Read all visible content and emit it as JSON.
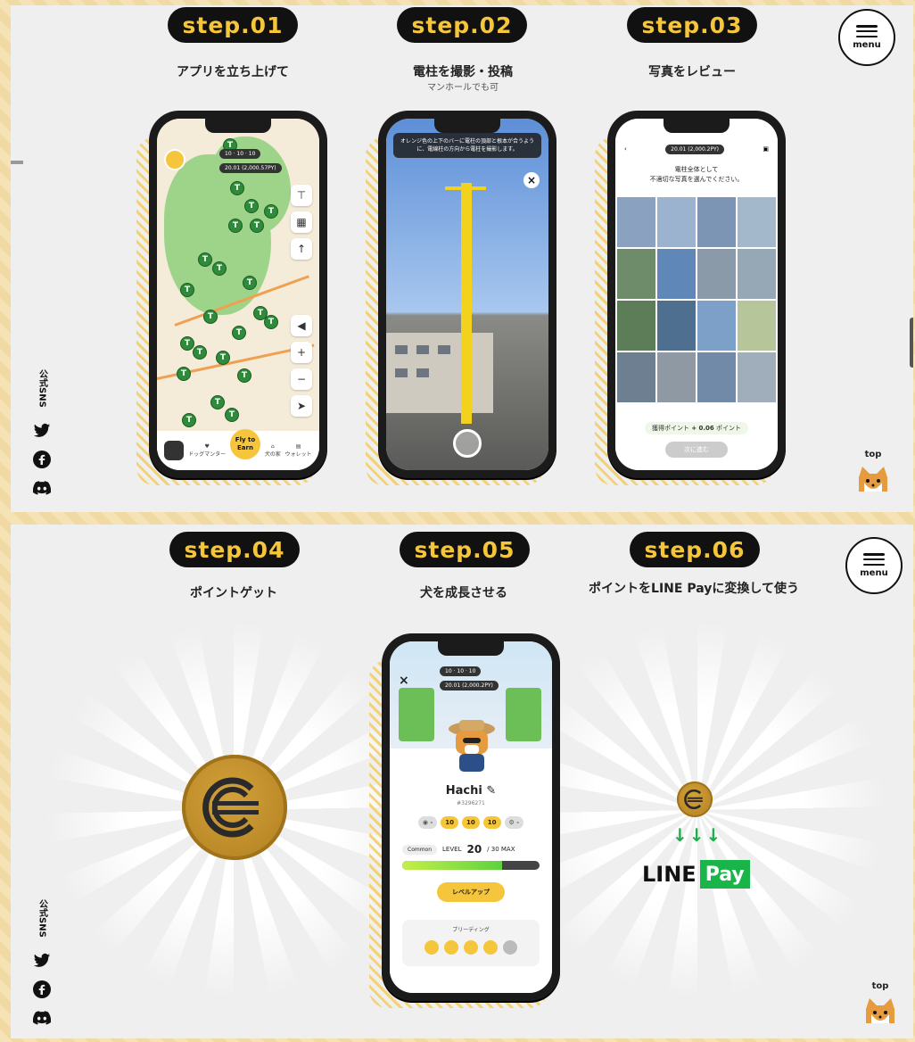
{
  "panel1": {
    "steps": [
      {
        "badge": "step.01",
        "title": "アプリを立ち上げて",
        "subtitle": ""
      },
      {
        "badge": "step.02",
        "title": "電柱を撮影・投稿",
        "subtitle": "マンホールでも可"
      },
      {
        "badge": "step.03",
        "title": "写真をレビュー",
        "subtitle": ""
      }
    ],
    "menu_label": "menu",
    "sns_label": "公式SNS",
    "top_label": "top",
    "map_screen": {
      "badge_counts": [
        "10",
        "10",
        "10"
      ],
      "balance": "20.01 (2,000.57PY)",
      "earn_button": "Fly to Earn",
      "nav": [
        "",
        "ドッグマンター",
        "",
        "犬の家",
        "ウォレット"
      ]
    },
    "camera_screen": {
      "banner": "オレンジ色の上下のバーに電柱の頂部と根本が合うように、電線柱の方向から電柱を撮影します。"
    },
    "review_screen": {
      "balance": "20.01 (2,000.2PY)",
      "question_line1": "電柱全体として",
      "question_line2": "不適切な写真を選んでください。",
      "points_label": "獲得ポイント",
      "points_value": "+ 0.06",
      "points_unit": "ポイント",
      "next_button": "次に進む"
    }
  },
  "panel2": {
    "steps": [
      {
        "badge": "step.04",
        "title": "ポイントゲット"
      },
      {
        "badge": "step.05",
        "title": "犬を成長させる"
      },
      {
        "badge": "step.06",
        "title": "ポイントをLINE Payに変換して使う"
      }
    ],
    "menu_label": "menu",
    "sns_label": "公式SNS",
    "top_label": "top",
    "dog_screen": {
      "balance": "20.01 (2,000.2PY)",
      "badge_counts": [
        "10",
        "10",
        "10"
      ],
      "dog_name": "Hachi",
      "dog_id": "#3296271",
      "chips": [
        "10",
        "10",
        "10"
      ],
      "rarity": "Common",
      "level_label": "LEVEL",
      "level": "20",
      "level_max": "/ 30 MAX",
      "xp_fraction": 0.73,
      "levelup_button": "レベルアップ",
      "breeding_title": "ブリーディング"
    },
    "line_pay": {
      "line": "LINE",
      "pay": "Pay",
      "arrows": "↓↓↓"
    }
  },
  "colors": {
    "badge_bg": "#111111",
    "badge_text": "#f5c63b",
    "panel_bg": "#efefef",
    "accent_green": "#19b44a"
  }
}
